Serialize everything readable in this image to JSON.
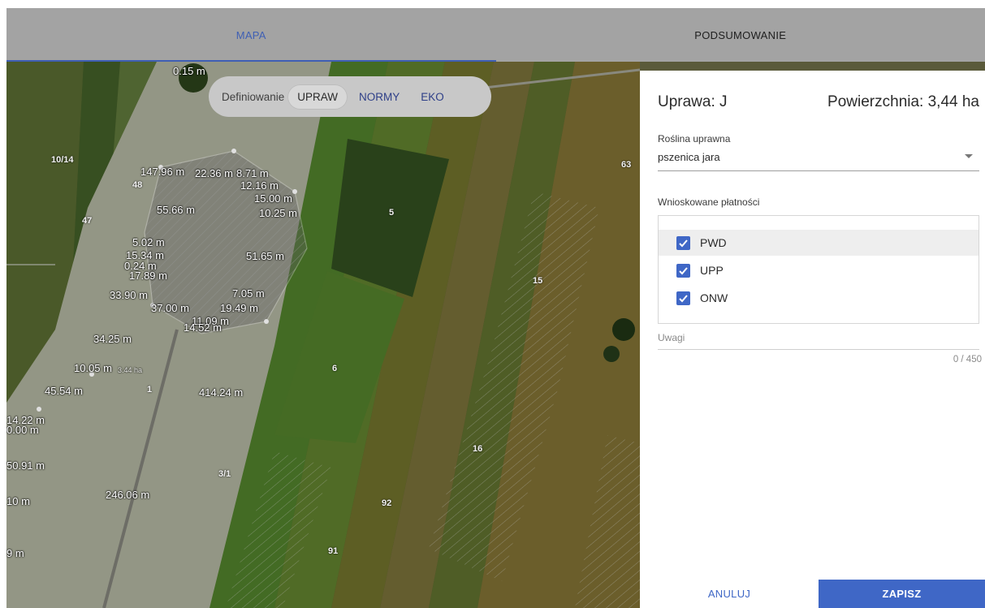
{
  "tabs": [
    {
      "label": "MAPA",
      "active": true
    },
    {
      "label": "PODSUMOWANIE",
      "active": false
    }
  ],
  "map": {
    "mode_label": "Definiowanie",
    "modes": [
      {
        "label": "UPRAW",
        "selected": true
      },
      {
        "label": "NORMY",
        "selected": false
      },
      {
        "label": "EKO",
        "selected": false
      }
    ],
    "measurements": [
      "0.15 m",
      "147.96 m",
      "22.36 m",
      "8.71 m",
      "12.16 m",
      "15.00 m",
      "10.25 m",
      "55.66 m",
      "5.02 m",
      "15.34 m",
      "0.24 m",
      "17.89 m",
      "51.65 m",
      "33.90 m",
      "37.00 m",
      "7.05 m",
      "19.49 m",
      "11.09 m",
      "14.52 m",
      "34.25 m",
      "10.05 m",
      "3.44 ha",
      "45.54 m",
      "414.24 m",
      "14.22 m",
      "0.00 m",
      "50.91 m",
      "246.06 m",
      "10 m",
      "9 m"
    ],
    "parcels": [
      "10/14",
      "48",
      "47",
      "5",
      "63",
      "15",
      "6",
      "1",
      "16",
      "3/1",
      "92",
      "91"
    ]
  },
  "panel": {
    "crop_title": "Uprawa: J",
    "area_title": "Powierzchnia: 3,44 ha",
    "plant_label": "Roślina uprawna",
    "plant_value": "pszenica jara",
    "payments_label": "Wnioskowane płatności",
    "payments": [
      {
        "label": "PWD",
        "checked": true
      },
      {
        "label": "UPP",
        "checked": true
      },
      {
        "label": "ONW",
        "checked": true
      }
    ],
    "notes_label": "Uwagi",
    "notes_counter": "0 / 450",
    "cancel_label": "ANULUJ",
    "save_label": "ZAPISZ"
  },
  "colors": {
    "accent": "#3f67c6",
    "tab_active": "#3f5fb4",
    "tabbar_bg": "#a3a3a3"
  }
}
